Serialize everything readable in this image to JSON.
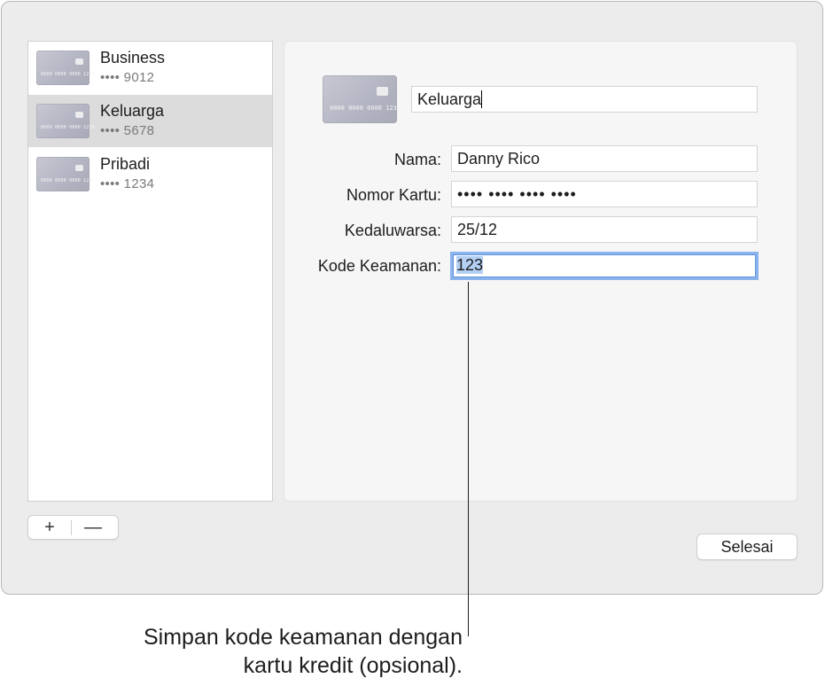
{
  "cards": [
    {
      "name": "Business",
      "number": "•••• 9012",
      "thumb_digits": "0000 0000 0000 1234"
    },
    {
      "name": "Keluarga",
      "number": "•••• 5678",
      "thumb_digits": "0000 0000 0000 1234"
    },
    {
      "name": "Pribadi",
      "number": "•••• 1234",
      "thumb_digits": "0000 0000 0000 1234"
    }
  ],
  "selected_card_index": 1,
  "list_buttons": {
    "add": "+",
    "remove": "—"
  },
  "detail": {
    "card_title": "Keluarga",
    "thumb_digits": "0000 0000 0000 1234",
    "fields": {
      "name": {
        "label": "Nama:",
        "value": "Danny Rico"
      },
      "card_number": {
        "label": "Nomor Kartu:",
        "value": "•••• •••• •••• ••••"
      },
      "expiry": {
        "label": "Kedaluwarsa:",
        "value": "25/12"
      },
      "security_code": {
        "label": "Kode Keamanan:",
        "value": "123"
      }
    }
  },
  "done_button": "Selesai",
  "callout": {
    "line1": "Simpan kode keamanan dengan",
    "line2": "kartu kredit (opsional)."
  }
}
